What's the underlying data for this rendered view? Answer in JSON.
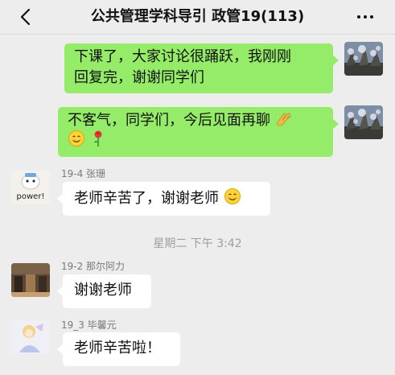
{
  "header": {
    "back_icon": "chevron-left-icon",
    "title": "公共管理学科导引 政管19(113)",
    "more_icon": "more-dots-icon"
  },
  "messages": [
    {
      "side": "right",
      "line1": "下课了，大家讨论很踊跃，我刚刚",
      "line2": "回复完，谢谢同学们"
    },
    {
      "side": "right",
      "text": "不客气，同学们，今后见面再聊",
      "emojis": [
        "clapping-hands-emoji",
        "smiley-emoji",
        "rose-emoji"
      ]
    },
    {
      "side": "left",
      "sender": "19-4 张珊",
      "avatar_text": "power!",
      "text": "老师辛苦了，谢谢老师",
      "emojis": [
        "smiley-emoji"
      ]
    },
    {
      "side": "left",
      "sender": "19-2 那尔阿力",
      "text": "谢谢老师"
    },
    {
      "side": "left",
      "sender": "19_3 毕馨元",
      "text": "老师辛苦啦！"
    }
  ],
  "timestamp": "星期二 下午 3:42",
  "colors": {
    "background": "#ededed",
    "own_bubble": "#95ec69",
    "other_bubble": "#ffffff",
    "sender_text": "#7a7a7a"
  }
}
